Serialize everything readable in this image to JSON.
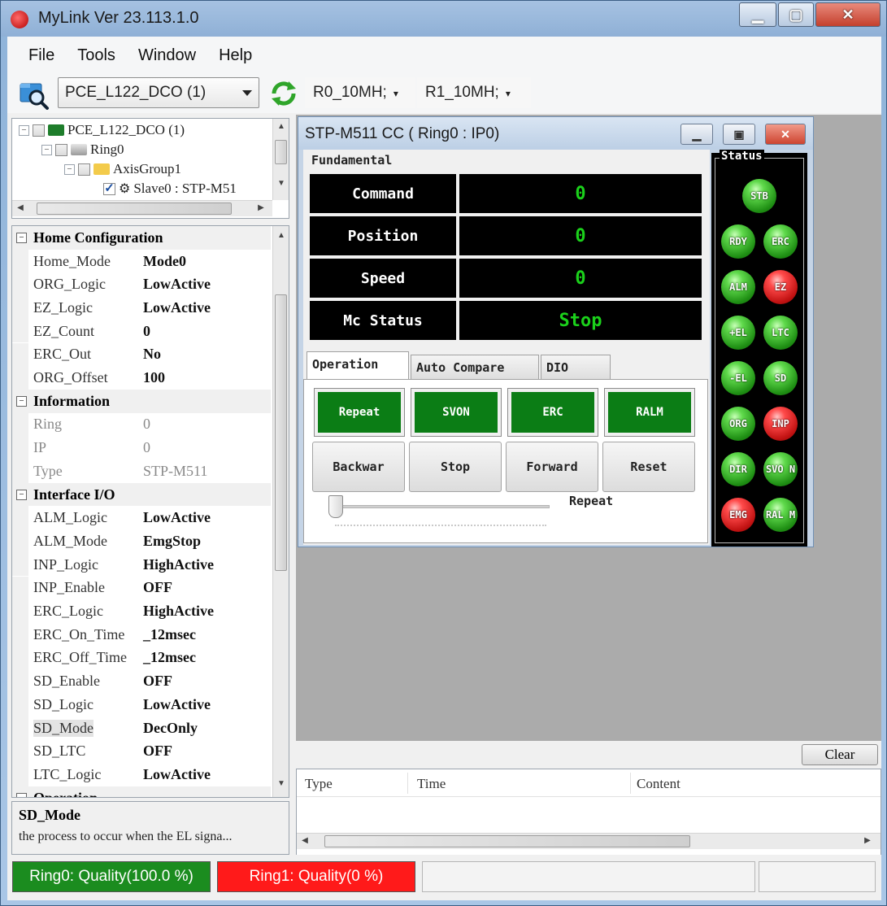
{
  "app": {
    "title": "MyLink  Ver 23.113.1.0"
  },
  "window_controls": {
    "minimize_icon": "minimize-icon",
    "maximize_icon": "maximize-icon",
    "close_icon": "close-icon"
  },
  "menu": [
    "File",
    "Tools",
    "Window",
    "Help"
  ],
  "toolbar": {
    "device": "PCE_L122_DCO (1)",
    "ring0": "R0_10MH;",
    "ring1": "R1_10MH;"
  },
  "tree": [
    {
      "label": "PCE_L122_DCO (1)",
      "icon": "card-icon"
    },
    {
      "label": "Ring0",
      "icon": "ring-icon"
    },
    {
      "label": "AxisGroup1",
      "icon": "folder-icon"
    },
    {
      "label": "Slave0 : STP-M51",
      "icon": "gear-icon"
    }
  ],
  "properties": [
    {
      "type": "category",
      "label": "Home Configuration"
    },
    {
      "type": "row",
      "name": "Home_Mode",
      "value": "Mode0"
    },
    {
      "type": "row",
      "name": "ORG_Logic",
      "value": "LowActive"
    },
    {
      "type": "row",
      "name": "EZ_Logic",
      "value": "LowActive"
    },
    {
      "type": "row",
      "name": "EZ_Count",
      "value": "0"
    },
    {
      "type": "row",
      "name": "ERC_Out",
      "value": "No"
    },
    {
      "type": "row",
      "name": "ORG_Offset",
      "value": "100"
    },
    {
      "type": "category",
      "label": "Information"
    },
    {
      "type": "row",
      "name": "Ring",
      "value": "0",
      "readonly": true
    },
    {
      "type": "row",
      "name": "IP",
      "value": "0",
      "readonly": true
    },
    {
      "type": "row",
      "name": "Type",
      "value": "STP-M511",
      "readonly": true
    },
    {
      "type": "category",
      "label": "Interface I/O"
    },
    {
      "type": "row",
      "name": "ALM_Logic",
      "value": "LowActive"
    },
    {
      "type": "row",
      "name": "ALM_Mode",
      "value": "EmgStop"
    },
    {
      "type": "row",
      "name": "INP_Logic",
      "value": "HighActive"
    },
    {
      "type": "row",
      "name": "INP_Enable",
      "value": "OFF"
    },
    {
      "type": "row",
      "name": "ERC_Logic",
      "value": "HighActive"
    },
    {
      "type": "row",
      "name": "ERC_On_Time",
      "value": "_12msec"
    },
    {
      "type": "row",
      "name": "ERC_Off_Time",
      "value": "_12msec"
    },
    {
      "type": "row",
      "name": "SD_Enable",
      "value": "OFF"
    },
    {
      "type": "row",
      "name": "SD_Logic",
      "value": "LowActive"
    },
    {
      "type": "row",
      "name": "SD_Mode",
      "value": "DecOnly",
      "selected": true
    },
    {
      "type": "row",
      "name": "SD_LTC",
      "value": "OFF"
    },
    {
      "type": "row",
      "name": "LTC_Logic",
      "value": "LowActive"
    },
    {
      "type": "category",
      "label": "Operation"
    }
  ],
  "description": {
    "title": "SD_Mode",
    "text": "the process to occur when the EL signa..."
  },
  "child_window": {
    "title": "STP-M511 CC ( Ring0 : IP0)",
    "fundamental_legend": "Fundamental",
    "displays": [
      {
        "label": "Command",
        "value": "0"
      },
      {
        "label": "Position",
        "value": "0"
      },
      {
        "label": "Speed",
        "value": "0"
      },
      {
        "label": "Mc Status",
        "value": "Stop"
      }
    ],
    "tabs": [
      "Operation",
      "Auto Compare",
      "DIO"
    ],
    "active_tab": "Operation",
    "toggle_buttons": [
      "Repeat",
      "SVON",
      "ERC",
      "RALM"
    ],
    "action_buttons": [
      "Backwar",
      "Stop",
      "Forward",
      "Reset"
    ],
    "slider_label": "Repeat",
    "status_legend": "Status",
    "leds": [
      {
        "label": "STB",
        "color": "green"
      },
      {
        "label": "RDY",
        "color": "green"
      },
      {
        "label": "ERC",
        "color": "green"
      },
      {
        "label": "ALM",
        "color": "green"
      },
      {
        "label": "EZ",
        "color": "red"
      },
      {
        "label": "+EL",
        "color": "green"
      },
      {
        "label": "LTC",
        "color": "green"
      },
      {
        "label": "-EL",
        "color": "green"
      },
      {
        "label": "SD",
        "color": "green"
      },
      {
        "label": "ORG",
        "color": "green"
      },
      {
        "label": "INP",
        "color": "red"
      },
      {
        "label": "DIR",
        "color": "green"
      },
      {
        "label": "SVO N",
        "color": "green"
      },
      {
        "label": "EMG",
        "color": "red"
      },
      {
        "label": "RAL M",
        "color": "green"
      }
    ]
  },
  "log": {
    "clear_label": "Clear",
    "columns": [
      "Type",
      "Time",
      "Content"
    ]
  },
  "statusbar": {
    "ring0": "Ring0: Quality(100.0 %)",
    "ring1": "Ring1: Quality(0 %)"
  },
  "colors": {
    "ok": "#1b8c1f",
    "error": "#ff1a1a",
    "display_value": "#1bd11b",
    "button_green": "#0b7d15",
    "mdi_background": "#ababab"
  }
}
